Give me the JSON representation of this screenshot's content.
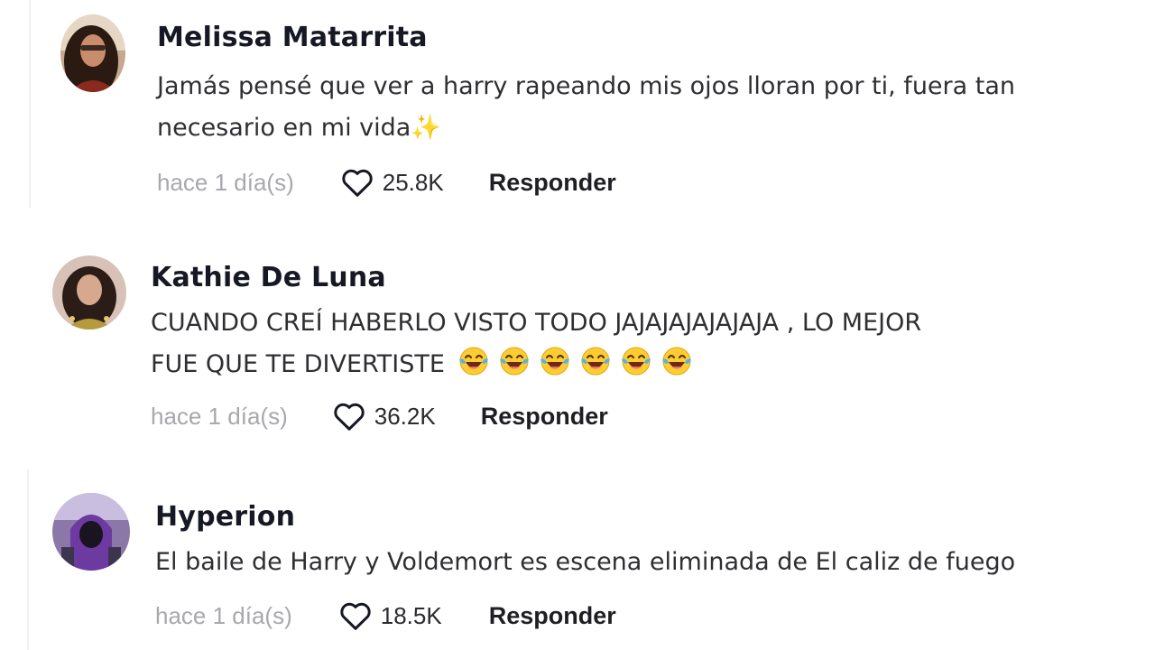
{
  "comments": [
    {
      "username": "Melissa Matarrita",
      "text_line1": "Jamás pensé que ver a harry rapeando mis ojos lloran por ti, fuera tan",
      "text_line2": "necesario en mi vida",
      "emoji": "✨",
      "timestamp": "hace 1 día(s)",
      "likes": "25.8K",
      "reply_label": "Responder",
      "avatar_icon": "user-avatar-photo"
    },
    {
      "username": "Kathie De Luna",
      "text_line1": "CUANDO CREÍ HABERLO VISTO TODO JAJAJAJAJAJAJA , LO MEJOR",
      "text_line2": "FUE QUE TE DIVERTISTE",
      "emoji_count": 6,
      "emoji_name": "face-with-tears-of-joy",
      "timestamp": "hace 1 día(s)",
      "likes": "36.2K",
      "reply_label": "Responder",
      "avatar_icon": "user-avatar-photo"
    },
    {
      "username": "Hyperion",
      "text_line1": "El baile de Harry y Voldemort es escena eliminada de El caliz de fuego",
      "timestamp": "hace 1 día(s)",
      "likes": "18.5K",
      "reply_label": "Responder",
      "avatar_icon": "user-avatar-illustration"
    }
  ],
  "icons": {
    "like": "heart-outline-icon"
  },
  "colors": {
    "username": "#161823",
    "body": "#2f2f33",
    "timestamp": "#a8a8ad"
  }
}
